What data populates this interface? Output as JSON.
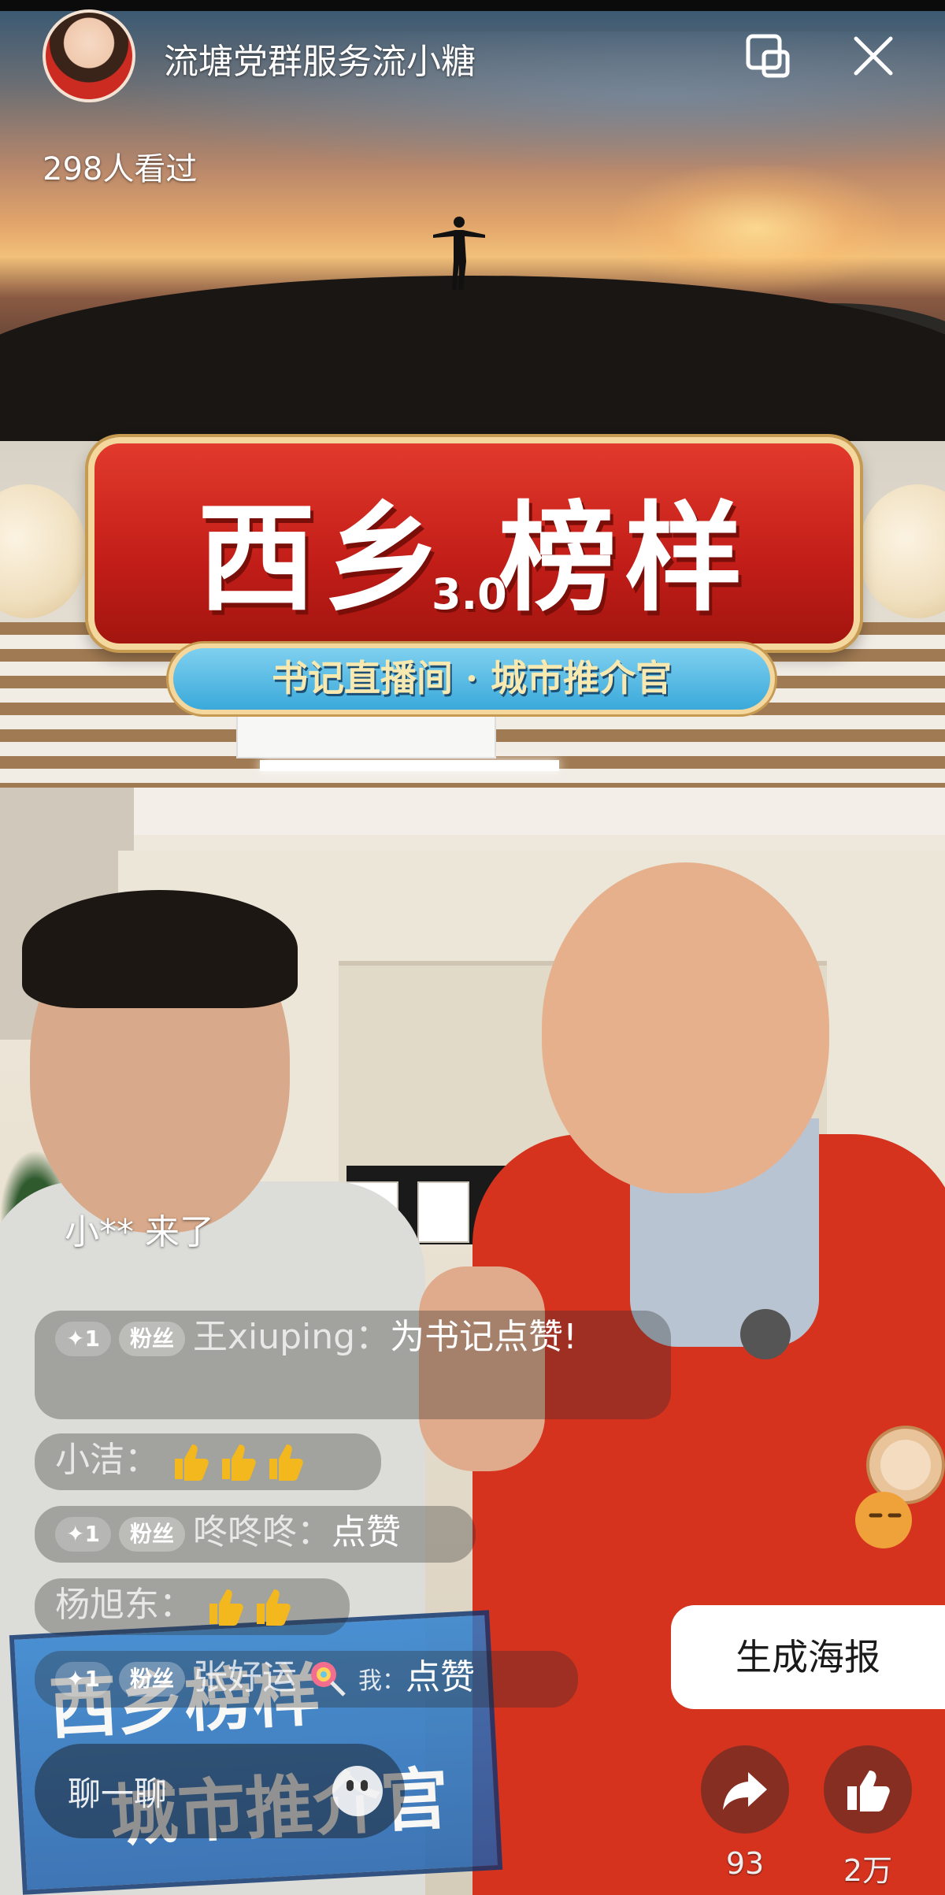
{
  "header": {
    "host_name": "流塘党群服务流小糖",
    "view_count": "298人看过"
  },
  "banner": {
    "title": "西乡 榜样",
    "version": "3.0",
    "subtitle": "书记直播间 · 城市推介官"
  },
  "placard": {
    "line1": "西乡榜样",
    "line2": "城市推介官"
  },
  "chat": {
    "join_notice": "小** 来了",
    "messages": [
      {
        "level": "✦1",
        "badge": "粉丝",
        "user": "王xiuping：",
        "text": "为书记点赞!"
      },
      {
        "user": "小洁：",
        "emoji": "thumbs-up x3"
      },
      {
        "level": "✦1",
        "badge": "粉丝",
        "user": "咚咚咚：",
        "text": "点赞"
      },
      {
        "user": "杨旭东：",
        "emoji": "thumbs-up x2"
      },
      {
        "level": "✦1",
        "badge": "粉丝",
        "user": "张好运",
        "me_tag": "我：",
        "text": "点赞"
      }
    ],
    "input_placeholder": "聊一聊"
  },
  "actions": {
    "poster_label": "生成海报",
    "share_count": "93",
    "like_count": "2万"
  },
  "colors": {
    "banner_red": "#c21d18",
    "banner_gold": "#f4d79c",
    "subtitle_blue": "#3aa9da",
    "vest_red": "#d6331f",
    "thumb_yellow": "#f3b81d"
  }
}
